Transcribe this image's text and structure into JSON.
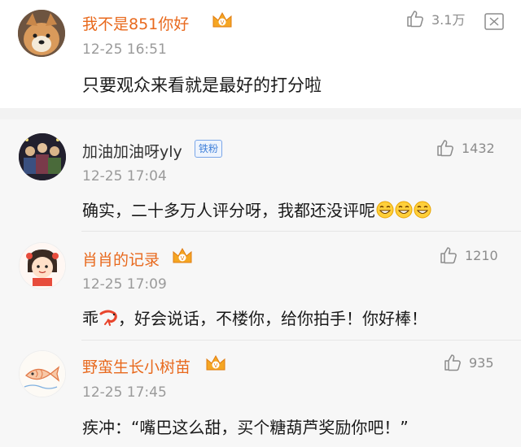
{
  "main_comment": {
    "username": "我不是851你好",
    "timestamp": "12-25 16:51",
    "text": "只要观众来看就是最好的打分啦",
    "like_count": "3.1万"
  },
  "replies": [
    {
      "username": "加油加油呀yly",
      "badge": "铁粉",
      "timestamp": "12-25 17:04",
      "text": "确实，二十多万人评分呀，我都还没评呢",
      "like_count": "1432"
    },
    {
      "username": "肖肖的记录",
      "timestamp": "12-25 17:09",
      "text_before_emoji": "乖",
      "text_after_emoji": "，好会说话，不楼你，给你拍手！你好棒！",
      "like_count": "1210"
    },
    {
      "username": "野蛮生长小树苗",
      "timestamp": "12-25 17:45",
      "text": "疾冲：“嘴巴这么甜，买个糖葫芦奖励你吧！”",
      "like_count": "935"
    }
  ],
  "colors": {
    "username_vip": "#e8691d",
    "username_normal": "#333333",
    "timestamp": "#9a9a9a",
    "reply_bg": "#f7f7f7"
  }
}
